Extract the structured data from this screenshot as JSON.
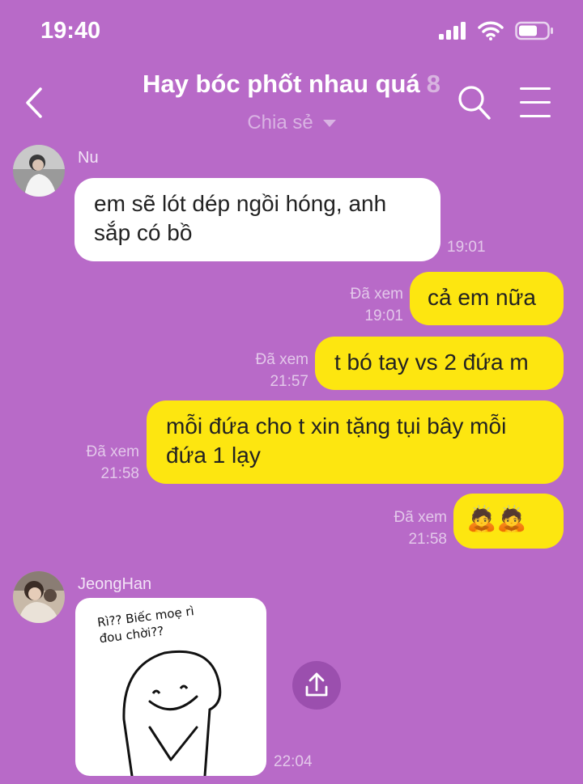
{
  "status_bar": {
    "time": "19:40"
  },
  "header": {
    "title": "Hay bóc phốt nhau quá",
    "member_count": "8",
    "subtitle": "Chia sẻ"
  },
  "messages": [
    {
      "sender": "Nu",
      "text": "em sẽ lót dép ngồi hóng, anh sắp có bồ",
      "time": "19:01"
    },
    {
      "status": "Đã xem",
      "time": "19:01",
      "text": "cả em nữa"
    },
    {
      "status": "Đã xem",
      "time": "21:57",
      "text": "t bó tay vs 2 đứa m"
    },
    {
      "status": "Đã xem",
      "time": "21:58",
      "text": "mỗi đứa cho t xin tặng tụi bây mỗi đứa 1 lạy"
    },
    {
      "status": "Đã xem",
      "time": "21:58",
      "text": "🙇🙇"
    },
    {
      "sender": "JeongHan",
      "sticker_text": "Rì?? Biếc moẹ rì đou chời??",
      "time": "22:04"
    }
  ],
  "colors": {
    "background": "#b86ac8",
    "outgoing_bubble": "#fde610",
    "incoming_bubble": "#ffffff"
  }
}
